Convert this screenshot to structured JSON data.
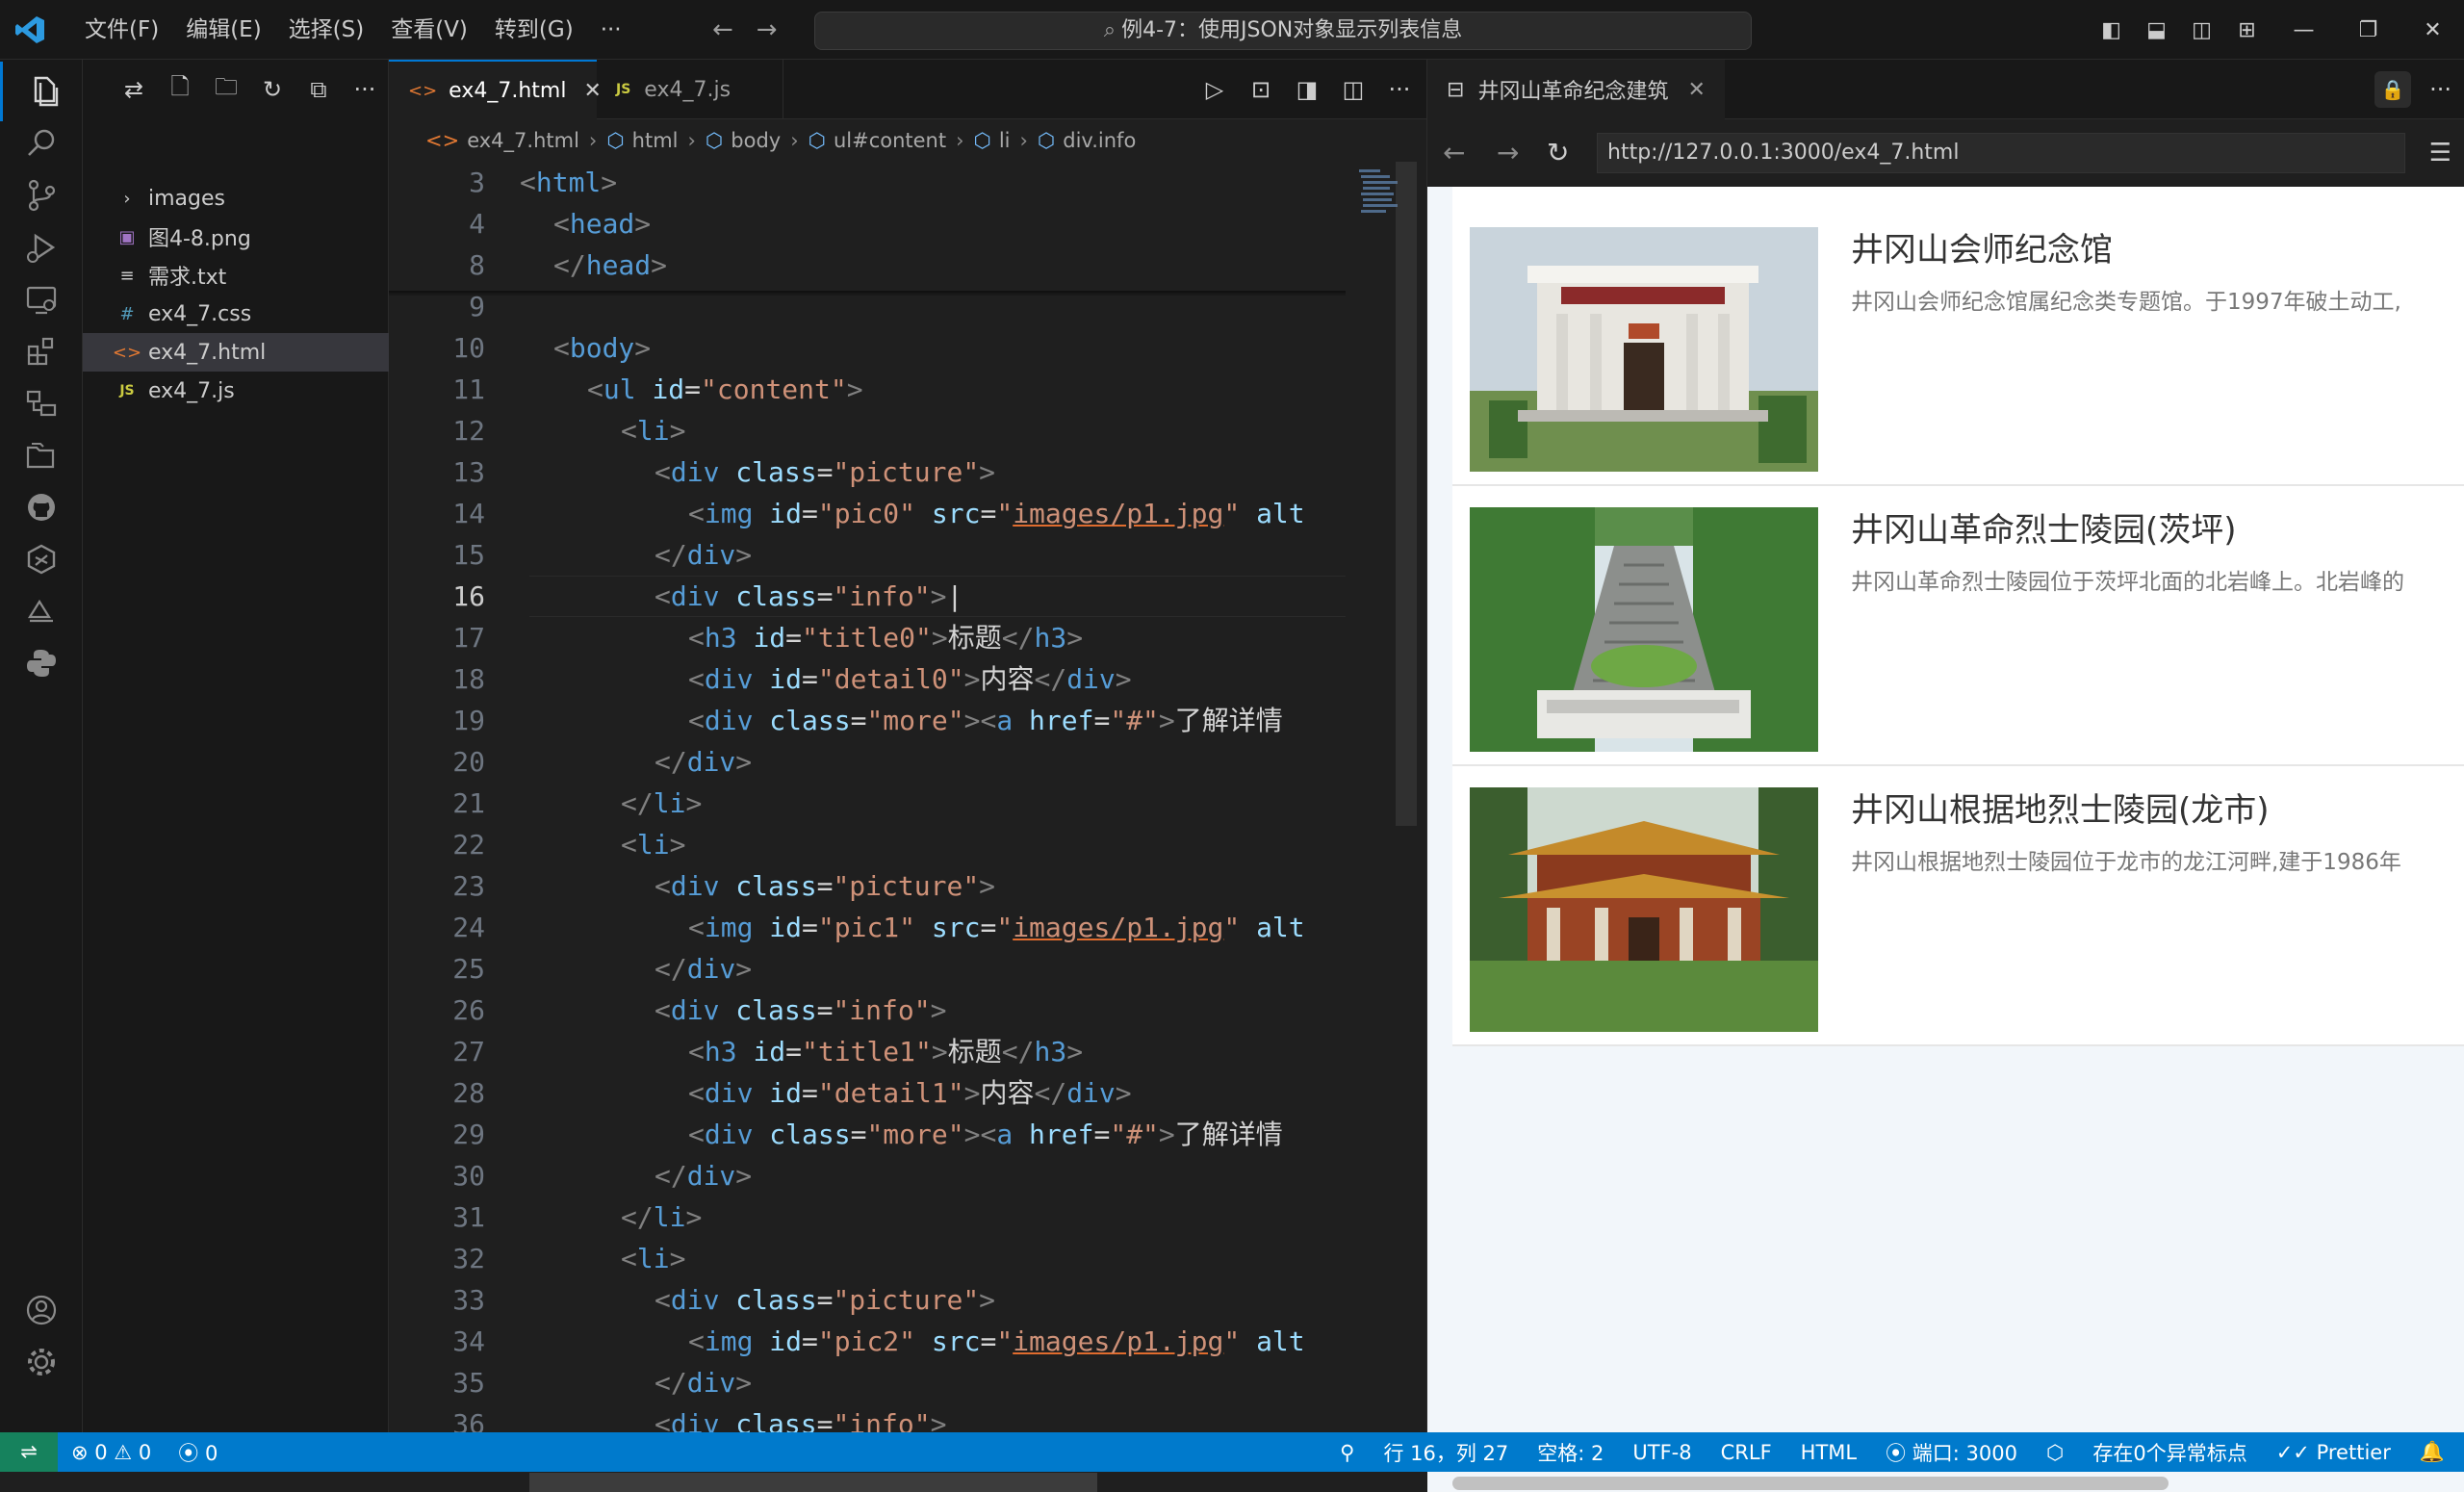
{
  "titlebar": {
    "menu": [
      "文件(F)",
      "编辑(E)",
      "选择(S)",
      "查看(V)",
      "转到(G)",
      "···"
    ],
    "command_center": "例4-7：使用JSON对象显示列表信息"
  },
  "explorer": {
    "items": [
      {
        "label": "images",
        "icon": "folder-chevron-icon"
      },
      {
        "label": "图4-8.png",
        "icon": "image-file-icon"
      },
      {
        "label": "需求.txt",
        "icon": "text-file-icon"
      },
      {
        "label": "ex4_7.css",
        "icon": "css-file-icon"
      },
      {
        "label": "ex4_7.html",
        "icon": "html-file-icon",
        "selected": true
      },
      {
        "label": "ex4_7.js",
        "icon": "js-file-icon"
      }
    ]
  },
  "editor": {
    "tabs": [
      {
        "label": "ex4_7.html",
        "active": true
      },
      {
        "label": "ex4_7.js",
        "active": false
      }
    ],
    "breadcrumb": [
      "ex4_7.html",
      "html",
      "body",
      "ul#content",
      "li",
      "div.info"
    ],
    "current_line": 16,
    "lines": [
      {
        "n": 3,
        "indent": 0,
        "tokens": [
          [
            "tag",
            "<"
          ],
          [
            "tn",
            "html"
          ],
          [
            "tag",
            ">"
          ]
        ]
      },
      {
        "n": 4,
        "indent": 1,
        "tokens": [
          [
            "tag",
            "<"
          ],
          [
            "tn",
            "head"
          ],
          [
            "tag",
            ">"
          ]
        ]
      },
      {
        "n": 8,
        "indent": 1,
        "tokens": [
          [
            "tag",
            "</"
          ],
          [
            "tn",
            "head"
          ],
          [
            "tag",
            ">"
          ]
        ]
      },
      {
        "n": 9,
        "indent": 0,
        "tokens": []
      },
      {
        "n": 10,
        "indent": 1,
        "tokens": [
          [
            "tag",
            "<"
          ],
          [
            "tn",
            "body"
          ],
          [
            "tag",
            ">"
          ]
        ]
      },
      {
        "n": 11,
        "indent": 2,
        "tokens": [
          [
            "tag",
            "<"
          ],
          [
            "tn",
            "ul"
          ],
          [
            "txt",
            " "
          ],
          [
            "an",
            "id"
          ],
          [
            "txt",
            "="
          ],
          [
            "av",
            "\"content\""
          ],
          [
            "tag",
            ">"
          ]
        ]
      },
      {
        "n": 12,
        "indent": 3,
        "tokens": [
          [
            "tag",
            "<"
          ],
          [
            "tn",
            "li"
          ],
          [
            "tag",
            ">"
          ]
        ]
      },
      {
        "n": 13,
        "indent": 4,
        "tokens": [
          [
            "tag",
            "<"
          ],
          [
            "tn",
            "div"
          ],
          [
            "txt",
            " "
          ],
          [
            "an",
            "class"
          ],
          [
            "txt",
            "="
          ],
          [
            "av",
            "\"picture\""
          ],
          [
            "tag",
            ">"
          ]
        ]
      },
      {
        "n": 14,
        "indent": 5,
        "tokens": [
          [
            "tag",
            "<"
          ],
          [
            "tn",
            "img"
          ],
          [
            "txt",
            " "
          ],
          [
            "an",
            "id"
          ],
          [
            "txt",
            "="
          ],
          [
            "av",
            "\"pic0\""
          ],
          [
            "txt",
            " "
          ],
          [
            "an",
            "src"
          ],
          [
            "txt",
            "="
          ],
          [
            "av",
            "\""
          ],
          [
            "link",
            "images/p1.jpg"
          ],
          [
            "av",
            "\""
          ],
          [
            "txt",
            " "
          ],
          [
            "an",
            "alt"
          ]
        ]
      },
      {
        "n": 15,
        "indent": 4,
        "tokens": [
          [
            "tag",
            "</"
          ],
          [
            "tn",
            "div"
          ],
          [
            "tag",
            ">"
          ]
        ]
      },
      {
        "n": 16,
        "indent": 4,
        "tokens": [
          [
            "tag",
            "<"
          ],
          [
            "tn",
            "div"
          ],
          [
            "txt",
            " "
          ],
          [
            "an",
            "class"
          ],
          [
            "txt",
            "="
          ],
          [
            "av",
            "\"info\""
          ],
          [
            "tag",
            ">"
          ],
          [
            "txt",
            "|"
          ]
        ]
      },
      {
        "n": 17,
        "indent": 5,
        "tokens": [
          [
            "tag",
            "<"
          ],
          [
            "tn",
            "h3"
          ],
          [
            "txt",
            " "
          ],
          [
            "an",
            "id"
          ],
          [
            "txt",
            "="
          ],
          [
            "av",
            "\"title0\""
          ],
          [
            "tag",
            ">"
          ],
          [
            "txt",
            "标题"
          ],
          [
            "tag",
            "</"
          ],
          [
            "tn",
            "h3"
          ],
          [
            "tag",
            ">"
          ]
        ]
      },
      {
        "n": 18,
        "indent": 5,
        "tokens": [
          [
            "tag",
            "<"
          ],
          [
            "tn",
            "div"
          ],
          [
            "txt",
            " "
          ],
          [
            "an",
            "id"
          ],
          [
            "txt",
            "="
          ],
          [
            "av",
            "\"detail0\""
          ],
          [
            "tag",
            ">"
          ],
          [
            "txt",
            "内容"
          ],
          [
            "tag",
            "</"
          ],
          [
            "tn",
            "div"
          ],
          [
            "tag",
            ">"
          ]
        ]
      },
      {
        "n": 19,
        "indent": 5,
        "tokens": [
          [
            "tag",
            "<"
          ],
          [
            "tn",
            "div"
          ],
          [
            "txt",
            " "
          ],
          [
            "an",
            "class"
          ],
          [
            "txt",
            "="
          ],
          [
            "av",
            "\"more\""
          ],
          [
            "tag",
            "><"
          ],
          [
            "tn",
            "a"
          ],
          [
            "txt",
            " "
          ],
          [
            "an",
            "href"
          ],
          [
            "txt",
            "="
          ],
          [
            "av",
            "\"#\""
          ],
          [
            "tag",
            ">"
          ],
          [
            "txt",
            "了解详情"
          ]
        ]
      },
      {
        "n": 20,
        "indent": 4,
        "tokens": [
          [
            "tag",
            "</"
          ],
          [
            "tn",
            "div"
          ],
          [
            "tag",
            ">"
          ]
        ]
      },
      {
        "n": 21,
        "indent": 3,
        "tokens": [
          [
            "tag",
            "</"
          ],
          [
            "tn",
            "li"
          ],
          [
            "tag",
            ">"
          ]
        ]
      },
      {
        "n": 22,
        "indent": 3,
        "tokens": [
          [
            "tag",
            "<"
          ],
          [
            "tn",
            "li"
          ],
          [
            "tag",
            ">"
          ]
        ]
      },
      {
        "n": 23,
        "indent": 4,
        "tokens": [
          [
            "tag",
            "<"
          ],
          [
            "tn",
            "div"
          ],
          [
            "txt",
            " "
          ],
          [
            "an",
            "class"
          ],
          [
            "txt",
            "="
          ],
          [
            "av",
            "\"picture\""
          ],
          [
            "tag",
            ">"
          ]
        ]
      },
      {
        "n": 24,
        "indent": 5,
        "tokens": [
          [
            "tag",
            "<"
          ],
          [
            "tn",
            "img"
          ],
          [
            "txt",
            " "
          ],
          [
            "an",
            "id"
          ],
          [
            "txt",
            "="
          ],
          [
            "av",
            "\"pic1\""
          ],
          [
            "txt",
            " "
          ],
          [
            "an",
            "src"
          ],
          [
            "txt",
            "="
          ],
          [
            "av",
            "\""
          ],
          [
            "link",
            "images/p1.jpg"
          ],
          [
            "av",
            "\""
          ],
          [
            "txt",
            " "
          ],
          [
            "an",
            "alt"
          ]
        ]
      },
      {
        "n": 25,
        "indent": 4,
        "tokens": [
          [
            "tag",
            "</"
          ],
          [
            "tn",
            "div"
          ],
          [
            "tag",
            ">"
          ]
        ]
      },
      {
        "n": 26,
        "indent": 4,
        "tokens": [
          [
            "tag",
            "<"
          ],
          [
            "tn",
            "div"
          ],
          [
            "txt",
            " "
          ],
          [
            "an",
            "class"
          ],
          [
            "txt",
            "="
          ],
          [
            "av",
            "\"info\""
          ],
          [
            "tag",
            ">"
          ]
        ]
      },
      {
        "n": 27,
        "indent": 5,
        "tokens": [
          [
            "tag",
            "<"
          ],
          [
            "tn",
            "h3"
          ],
          [
            "txt",
            " "
          ],
          [
            "an",
            "id"
          ],
          [
            "txt",
            "="
          ],
          [
            "av",
            "\"title1\""
          ],
          [
            "tag",
            ">"
          ],
          [
            "txt",
            "标题"
          ],
          [
            "tag",
            "</"
          ],
          [
            "tn",
            "h3"
          ],
          [
            "tag",
            ">"
          ]
        ]
      },
      {
        "n": 28,
        "indent": 5,
        "tokens": [
          [
            "tag",
            "<"
          ],
          [
            "tn",
            "div"
          ],
          [
            "txt",
            " "
          ],
          [
            "an",
            "id"
          ],
          [
            "txt",
            "="
          ],
          [
            "av",
            "\"detail1\""
          ],
          [
            "tag",
            ">"
          ],
          [
            "txt",
            "内容"
          ],
          [
            "tag",
            "</"
          ],
          [
            "tn",
            "div"
          ],
          [
            "tag",
            ">"
          ]
        ]
      },
      {
        "n": 29,
        "indent": 5,
        "tokens": [
          [
            "tag",
            "<"
          ],
          [
            "tn",
            "div"
          ],
          [
            "txt",
            " "
          ],
          [
            "an",
            "class"
          ],
          [
            "txt",
            "="
          ],
          [
            "av",
            "\"more\""
          ],
          [
            "tag",
            "><"
          ],
          [
            "tn",
            "a"
          ],
          [
            "txt",
            " "
          ],
          [
            "an",
            "href"
          ],
          [
            "txt",
            "="
          ],
          [
            "av",
            "\"#\""
          ],
          [
            "tag",
            ">"
          ],
          [
            "txt",
            "了解详情"
          ]
        ]
      },
      {
        "n": 30,
        "indent": 4,
        "tokens": [
          [
            "tag",
            "</"
          ],
          [
            "tn",
            "div"
          ],
          [
            "tag",
            ">"
          ]
        ]
      },
      {
        "n": 31,
        "indent": 3,
        "tokens": [
          [
            "tag",
            "</"
          ],
          [
            "tn",
            "li"
          ],
          [
            "tag",
            ">"
          ]
        ]
      },
      {
        "n": 32,
        "indent": 3,
        "tokens": [
          [
            "tag",
            "<"
          ],
          [
            "tn",
            "li"
          ],
          [
            "tag",
            ">"
          ]
        ]
      },
      {
        "n": 33,
        "indent": 4,
        "tokens": [
          [
            "tag",
            "<"
          ],
          [
            "tn",
            "div"
          ],
          [
            "txt",
            " "
          ],
          [
            "an",
            "class"
          ],
          [
            "txt",
            "="
          ],
          [
            "av",
            "\"picture\""
          ],
          [
            "tag",
            ">"
          ]
        ]
      },
      {
        "n": 34,
        "indent": 5,
        "tokens": [
          [
            "tag",
            "<"
          ],
          [
            "tn",
            "img"
          ],
          [
            "txt",
            " "
          ],
          [
            "an",
            "id"
          ],
          [
            "txt",
            "="
          ],
          [
            "av",
            "\"pic2\""
          ],
          [
            "txt",
            " "
          ],
          [
            "an",
            "src"
          ],
          [
            "txt",
            "="
          ],
          [
            "av",
            "\""
          ],
          [
            "link",
            "images/p1.jpg"
          ],
          [
            "av",
            "\""
          ],
          [
            "txt",
            " "
          ],
          [
            "an",
            "alt"
          ]
        ]
      },
      {
        "n": 35,
        "indent": 4,
        "tokens": [
          [
            "tag",
            "</"
          ],
          [
            "tn",
            "div"
          ],
          [
            "tag",
            ">"
          ]
        ]
      },
      {
        "n": 36,
        "indent": 4,
        "tokens": [
          [
            "tag",
            "<"
          ],
          [
            "tn",
            "div"
          ],
          [
            "txt",
            " "
          ],
          [
            "an",
            "class"
          ],
          [
            "txt",
            "="
          ],
          [
            "av",
            "\"info\""
          ],
          [
            "tag",
            ">"
          ]
        ]
      }
    ]
  },
  "preview": {
    "tab_title": "井冈山革命纪念建筑",
    "url": "http://127.0.0.1:3000/ex4_7.html",
    "items": [
      {
        "title": "井冈山会师纪念馆",
        "detail": "井冈山会师纪念馆属纪念类专题馆。于1997年破土动工,",
        "image": "memorial-hall-photo"
      },
      {
        "title": "井冈山革命烈士陵园(茨坪)",
        "detail": "井冈山革命烈士陵园位于茨坪北面的北岩峰上。北岩峰的",
        "image": "cemetery-stairs-photo"
      },
      {
        "title": "井冈山根据地烈士陵园(龙市)",
        "detail": "井冈山根据地烈士陵园位于龙市的龙江河畔,建于1986年",
        "image": "pavilion-photo"
      }
    ]
  },
  "statusbar": {
    "errors": "0",
    "warnings": "0",
    "ports": "0",
    "position": "行 16，列 27",
    "spaces": "空格: 2",
    "encoding": "UTF-8",
    "eol": "CRLF",
    "language": "HTML",
    "port": "端口: 3000",
    "anomaly": "存在0个异常标点",
    "prettier": "Prettier"
  },
  "colors": {
    "accent": "#0078d4",
    "statusbar": "#007acc",
    "remote": "#16825d"
  }
}
